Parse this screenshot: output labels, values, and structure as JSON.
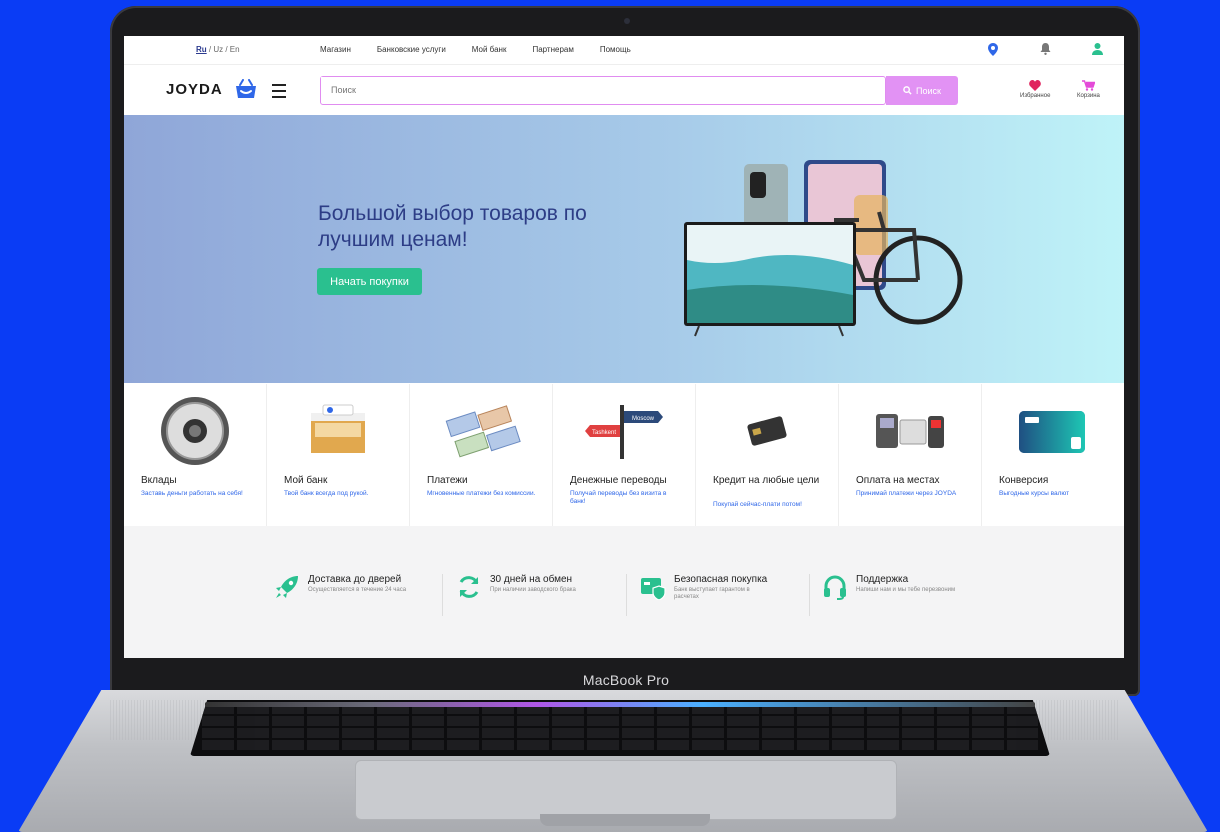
{
  "topbar": {
    "lang_active": "Ru",
    "lang_sep1": " / ",
    "lang_uz": "Uz",
    "lang_sep2": " / ",
    "lang_en": "En",
    "nav": [
      "Магазин",
      "Банковские услуги",
      "Мой банк",
      "Партнерам",
      "Помощь"
    ]
  },
  "header": {
    "logo": "JOYDA",
    "search_placeholder": "Поиск",
    "search_button": "Поиск",
    "favorites_label": "Избранное",
    "cart_label": "Корзина"
  },
  "hero": {
    "title": "Большой выбор товаров по лучшим ценам!",
    "button": "Начать покупки",
    "sign_top": "Moscow",
    "sign_bottom": "Tashkent"
  },
  "services": [
    {
      "title": "Вклады",
      "subtitle": "Заставь деньги работать на себя!"
    },
    {
      "title": "Мой банк",
      "subtitle": "Твой банк всегда под рукой."
    },
    {
      "title": "Платежи",
      "subtitle": "Мгновенные платежи без комиссии."
    },
    {
      "title": "Денежные переводы",
      "subtitle": "Получай переводы без визита в банк!"
    },
    {
      "title": "Кредит на любые цели",
      "subtitle": "Покупай сейчас-плати потом!"
    },
    {
      "title": "Оплата на местах",
      "subtitle": "Принимай платежи через JOYDA"
    },
    {
      "title": "Конверсия",
      "subtitle": "Выгодные курсы валют"
    }
  ],
  "features": [
    {
      "title": "Доставка до дверей",
      "subtitle": "Осуществляется в течение 24 часа"
    },
    {
      "title": "30 дней на обмен",
      "subtitle": "При наличии заводского брака"
    },
    {
      "title": "Безопасная покупка",
      "subtitle": "Банк выступает гарантом в расчетах"
    },
    {
      "title": "Поддержка",
      "subtitle": "Напиши нам и мы тебе перезвоним"
    }
  ],
  "device": {
    "model": "MacBook Pro"
  },
  "colors": {
    "accent": "#2ac08f",
    "search": "#e292f4",
    "brand_blue": "#2f67e8",
    "background": "#0a3cf5"
  },
  "icons": [
    "location-pin-icon",
    "bell-icon",
    "user-icon",
    "heart-icon",
    "cart-icon",
    "search-icon",
    "rocket-icon",
    "refresh-icon",
    "shield-card-icon",
    "headset-icon"
  ]
}
